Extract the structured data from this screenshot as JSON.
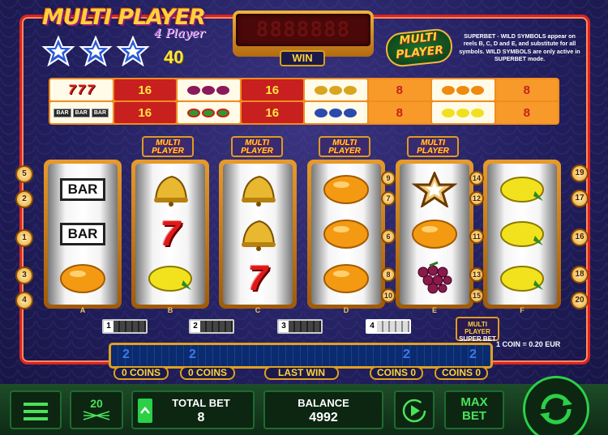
{
  "game": {
    "title": "MULTI PLAYER",
    "subtitle": "4 Player",
    "lines": "40",
    "badge": "MULTI PLAYER",
    "win_display": "8888888",
    "win_label": "WIN",
    "rules": "SUPERBET - WILD SYMBOLS appear on reels B, C, D and E, and substitute for all symbols. WILD SYMBOLS are only active in SUPERBET mode."
  },
  "paytable": {
    "left": [
      {
        "symbols": "777",
        "value": "16"
      },
      {
        "symbols": "grapes",
        "value": "16"
      },
      {
        "symbols": "BAR BAR BAR",
        "value": "16"
      },
      {
        "symbols": "watermelon",
        "value": "16"
      }
    ],
    "right": [
      {
        "symbols": "bells",
        "value": "8"
      },
      {
        "symbols": "oranges",
        "value": "8"
      },
      {
        "symbols": "plums",
        "value": "8"
      },
      {
        "symbols": "lemons",
        "value": "8"
      }
    ],
    "bar_chip": "BAR"
  },
  "reels": {
    "header_label": "MULTI PLAYER",
    "letters": [
      "A",
      "B",
      "C",
      "D",
      "E",
      "F"
    ],
    "columns": [
      [
        "BAR",
        "BAR",
        "orange"
      ],
      [
        "bell",
        "7",
        "lemon"
      ],
      [
        "bell",
        "bell",
        "7"
      ],
      [
        "orange",
        "orange",
        "orange"
      ],
      [
        "star",
        "orange",
        "grapes"
      ],
      [
        "lemon",
        "lemon",
        "lemon"
      ]
    ]
  },
  "line_markers": {
    "left": [
      "5",
      "2",
      "1",
      "3",
      "4"
    ],
    "mid": [
      "9",
      "7",
      "6",
      "8",
      "10"
    ],
    "mid2": [
      "14",
      "12",
      "11",
      "13",
      "15"
    ],
    "right": [
      "19",
      "17",
      "16",
      "18",
      "20"
    ]
  },
  "coin_slots": [
    "1",
    "2",
    "3",
    "4"
  ],
  "superbet_label": "SUPER BET",
  "coin_value": "1 COIN = 0.20 EUR",
  "coin_bar": {
    "labels": [
      "0 COINS",
      "0 COINS",
      "LAST WIN",
      "COINS 0",
      "COINS 0"
    ],
    "digits": "2"
  },
  "bottom": {
    "lines_value": "20",
    "total_bet_label": "TOTAL BET",
    "total_bet_value": "8",
    "balance_label": "BALANCE",
    "balance_value": "4992",
    "max_bet_line1": "MAX",
    "max_bet_line2": "BET"
  },
  "colors": {
    "accent": "#2bd047",
    "frame": "#d9241f",
    "gold": "#ffd23a"
  },
  "icons": [
    "menu-icon",
    "lines-icon",
    "arrow-up-icon",
    "autoplay-icon",
    "spin-icon"
  ]
}
